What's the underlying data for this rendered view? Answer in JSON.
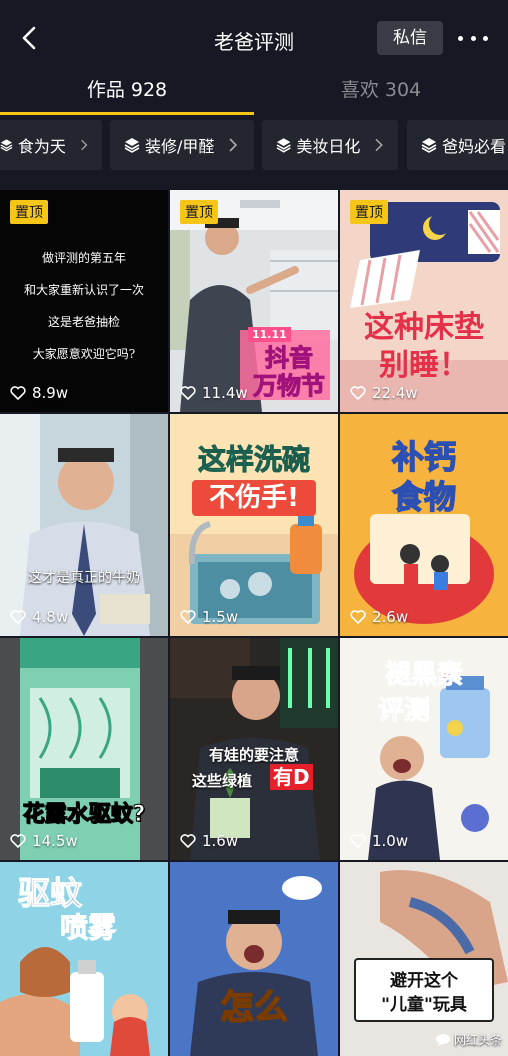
{
  "header": {
    "title": "老爸评测",
    "dm_label": "私信",
    "back_icon": "chevron-left-icon",
    "more_icon": "more-dots-icon"
  },
  "tabs": [
    {
      "label": "作品 928",
      "active": true
    },
    {
      "label": "喜欢 304",
      "active": false
    }
  ],
  "collections": [
    {
      "label": "食为天"
    },
    {
      "label": "装修/甲醛"
    },
    {
      "label": "美妆日化"
    },
    {
      "label": "爸妈必看"
    }
  ],
  "colors": {
    "background": "#161823",
    "accent": "#f5c518",
    "chip_bg": "#23252f"
  },
  "videos": [
    {
      "pinned": "置顶",
      "likes": "8.9w",
      "lines": [
        "做评测的第五年",
        "和大家重新认识了一次",
        "这是老爸抽检",
        "大家愿意欢迎它吗?"
      ]
    },
    {
      "pinned": "置顶",
      "likes": "11.4w",
      "caption": "抖音 万物节",
      "badge": "11.11"
    },
    {
      "pinned": "置顶",
      "likes": "22.4w",
      "caption1": "这种床垫",
      "caption2": "别睡！"
    },
    {
      "likes": "4.8w",
      "caption": "这才是真正的牛奶"
    },
    {
      "likes": "1.5w",
      "caption1": "这样洗碗",
      "caption2": "不伤手!"
    },
    {
      "likes": "2.6w",
      "caption1": "补钙",
      "caption2": "食物"
    },
    {
      "likes": "14.5w",
      "caption": "花露水驱蚊?"
    },
    {
      "likes": "1.6w",
      "caption1": "有娃的要注意",
      "caption2": "这些绿植",
      "caption3": "有D"
    },
    {
      "likes": "1.0w",
      "caption1": "褪黑素",
      "caption2": "评测"
    },
    {
      "caption1": "驱蚊",
      "caption2": "喷雾"
    },
    {
      "caption": "怎么"
    },
    {
      "caption1": "避开这个",
      "caption2": "\"儿童\"玩具"
    }
  ],
  "watermark": "网红头条"
}
